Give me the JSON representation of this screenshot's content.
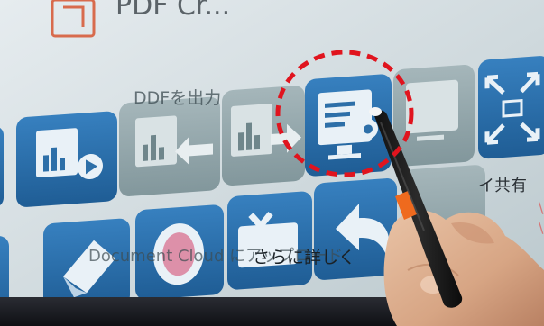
{
  "photo": {
    "screen_title_fragment": "PDF Cr...",
    "overlay_label_top": "DDFを出力",
    "overlay_label_bottom": "Document Cloud にアップロード",
    "more_details_label": "さらに詳しく",
    "share_label": "イ共有",
    "checkmark": "✓",
    "highlight_color": "#e0141e",
    "tile_color": "#2a6ea8",
    "gray_tile_color": "#8fa2a8",
    "pen_accent_color": "#ef6a1e"
  }
}
